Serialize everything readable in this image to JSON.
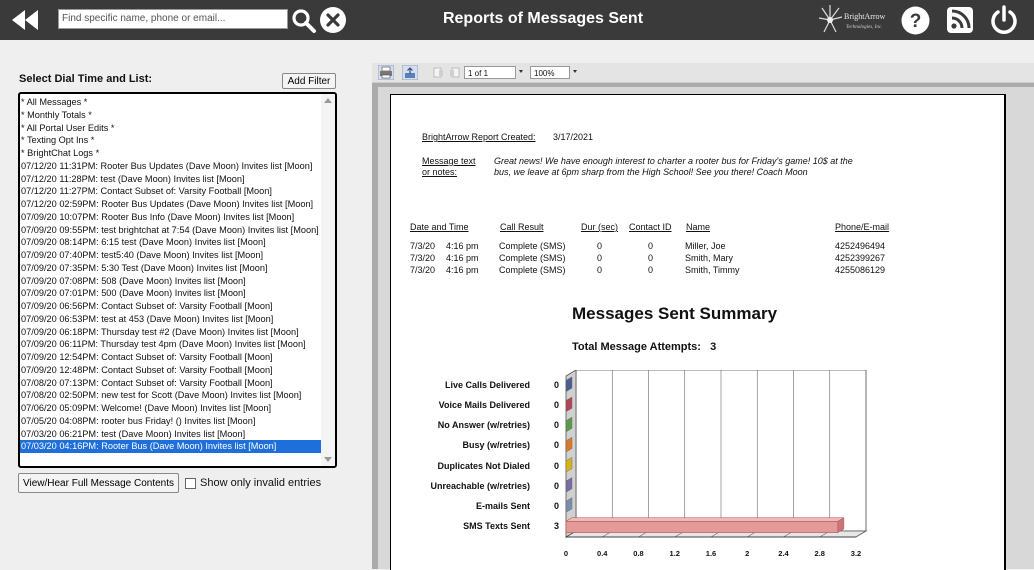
{
  "header": {
    "title": "Reports of Messages Sent",
    "search_placeholder": "Find specific name, phone or email...",
    "logo_text": "BrightArrow Technologies, Inc."
  },
  "left_panel": {
    "label": "Select Dial Time and List:",
    "add_filter": "Add Filter",
    "items": [
      "* All Messages *",
      "* Monthly Totals *",
      "* All Portal User Edits *",
      "* Texting Opt Ins *",
      "* BrightChat Logs *",
      "07/12/20 11:31PM: Rooter Bus Updates (Dave Moon) Invites list [Moon]",
      "07/12/20 11:28PM: test (Dave Moon) Invites list [Moon]",
      "07/12/20 11:27PM: Contact Subset of: Varsity Football [Moon]",
      "07/12/20 02:59PM: Rooter Bus Updates (Dave Moon) Invites list [Moon]",
      "07/09/20 10:07PM: Rooter Bus Info (Dave Moon) Invites list [Moon]",
      "07/09/20 09:55PM: test brightchat at 7:54 (Dave Moon) Invites list [Moon]",
      "07/09/20 08:14PM: 6:15 test (Dave Moon) Invites list [Moon]",
      "07/09/20 07:40PM: test5:40 (Dave Moon) Invites list [Moon]",
      "07/09/20 07:35PM: 5:30 Test (Dave Moon) Invites list [Moon]",
      "07/09/20 07:08PM: 508 (Dave Moon) Invites list [Moon]",
      "07/09/20 07:01PM: 500 (Dave Moon) Invites list [Moon]",
      "07/09/20 06:56PM: Contact Subset of: Varsity Football [Moon]",
      "07/09/20 06:53PM: test at 453 (Dave Moon) Invites list [Moon]",
      "07/09/20 06:18PM: Thursday test #2 (Dave Moon) Invites list [Moon]",
      "07/09/20 06:11PM: Thursday test 4pm (Dave Moon) Invites list [Moon]",
      "07/09/20 12:54PM: Contact Subset of: Varsity Football [Moon]",
      "07/09/20 12:48PM: Contact Subset of: Varsity Football [Moon]",
      "07/08/20 07:13PM: Contact Subset of: Varsity Football [Moon]",
      "07/08/20 02:50PM: new test for Scott (Dave Moon) Invites list [Moon]",
      "07/06/20 05:09PM: Welcome! (Dave Moon) Invites list [Moon]",
      "07/05/20 04:08PM: rooter bus Friday! () Invites list [Moon]",
      "07/03/20 06:21PM: test (Dave Moon) Invites list [Moon]",
      "07/03/20 04:16PM: Rooter Bus (Dave Moon) Invites list [Moon]"
    ],
    "selected_index": 27,
    "view_button": "View/Hear Full Message Contents",
    "checkbox_label": "Show only invalid entries"
  },
  "viewer": {
    "page_indicator": "1 of 1",
    "zoom": "100%"
  },
  "report": {
    "created_label": "BrightArrow Report Created:",
    "created_value": "3/17/2021",
    "message_label_1": "Message text",
    "message_label_2": "or notes:",
    "message_line_1": "Great news! We have enough interest to charter a rooter bus for Friday's game!  10$ at the",
    "message_line_2": "bus, we leave at 6pm sharp from the High School! See you there! Coach Moon",
    "columns": [
      "Date and Time",
      "Call Result",
      "Dur (sec)",
      "Contact ID",
      "Name",
      "Phone/E-mail"
    ],
    "rows": [
      {
        "date": "7/3/20",
        "time": "4:16 pm",
        "result": "Complete (SMS)",
        "dur": "0",
        "contact_id": "0",
        "name": "Miller, Joe",
        "phone": "4252496494"
      },
      {
        "date": "7/3/20",
        "time": "4:16 pm",
        "result": "Complete (SMS)",
        "dur": "0",
        "contact_id": "0",
        "name": "Smith, Mary",
        "phone": "4252399267"
      },
      {
        "date": "7/3/20",
        "time": "4:16 pm",
        "result": "Complete (SMS)",
        "dur": "0",
        "contact_id": "0",
        "name": "Smith, Timmy",
        "phone": "4255086129"
      }
    ],
    "summary_title": "Messages Sent Summary",
    "attempts_label": "Total Message Attempts:",
    "attempts_value": "3"
  },
  "chart_data": {
    "type": "bar",
    "orientation": "horizontal",
    "categories": [
      "Live Calls Delivered",
      "Voice Mails Delivered",
      "No Answer (w/retries)",
      "Busy (w/retries)",
      "Duplicates Not Dialed",
      "Unreachable (w/retries)",
      "E-mails Sent",
      "SMS Texts Sent"
    ],
    "values": [
      0,
      0,
      0,
      0,
      0,
      0,
      0,
      3
    ],
    "colors": [
      "#4b5e8f",
      "#b0455a",
      "#5a9a4a",
      "#d8792d",
      "#d3b41a",
      "#7a6ba0",
      "#7a8ea8",
      "#e59a9a"
    ],
    "xlim": [
      0,
      3.2
    ],
    "x_ticks": [
      "0",
      "0.4",
      "0.8",
      "1.2",
      "1.6",
      "2",
      "2.4",
      "2.8",
      "3.2"
    ],
    "grid": true,
    "style": "3d"
  }
}
